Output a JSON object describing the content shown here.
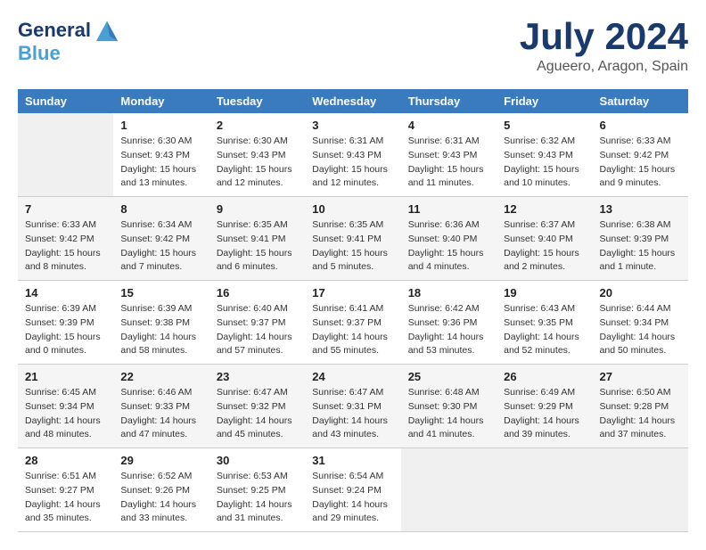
{
  "header": {
    "logo_line1": "General",
    "logo_line2": "Blue",
    "month": "July 2024",
    "location": "Agueero, Aragon, Spain"
  },
  "weekdays": [
    "Sunday",
    "Monday",
    "Tuesday",
    "Wednesday",
    "Thursday",
    "Friday",
    "Saturday"
  ],
  "weeks": [
    [
      {
        "day": "",
        "info": ""
      },
      {
        "day": "1",
        "info": "Sunrise: 6:30 AM\nSunset: 9:43 PM\nDaylight: 15 hours\nand 13 minutes."
      },
      {
        "day": "2",
        "info": "Sunrise: 6:30 AM\nSunset: 9:43 PM\nDaylight: 15 hours\nand 12 minutes."
      },
      {
        "day": "3",
        "info": "Sunrise: 6:31 AM\nSunset: 9:43 PM\nDaylight: 15 hours\nand 12 minutes."
      },
      {
        "day": "4",
        "info": "Sunrise: 6:31 AM\nSunset: 9:43 PM\nDaylight: 15 hours\nand 11 minutes."
      },
      {
        "day": "5",
        "info": "Sunrise: 6:32 AM\nSunset: 9:43 PM\nDaylight: 15 hours\nand 10 minutes."
      },
      {
        "day": "6",
        "info": "Sunrise: 6:33 AM\nSunset: 9:42 PM\nDaylight: 15 hours\nand 9 minutes."
      }
    ],
    [
      {
        "day": "7",
        "info": "Sunrise: 6:33 AM\nSunset: 9:42 PM\nDaylight: 15 hours\nand 8 minutes."
      },
      {
        "day": "8",
        "info": "Sunrise: 6:34 AM\nSunset: 9:42 PM\nDaylight: 15 hours\nand 7 minutes."
      },
      {
        "day": "9",
        "info": "Sunrise: 6:35 AM\nSunset: 9:41 PM\nDaylight: 15 hours\nand 6 minutes."
      },
      {
        "day": "10",
        "info": "Sunrise: 6:35 AM\nSunset: 9:41 PM\nDaylight: 15 hours\nand 5 minutes."
      },
      {
        "day": "11",
        "info": "Sunrise: 6:36 AM\nSunset: 9:40 PM\nDaylight: 15 hours\nand 4 minutes."
      },
      {
        "day": "12",
        "info": "Sunrise: 6:37 AM\nSunset: 9:40 PM\nDaylight: 15 hours\nand 2 minutes."
      },
      {
        "day": "13",
        "info": "Sunrise: 6:38 AM\nSunset: 9:39 PM\nDaylight: 15 hours\nand 1 minute."
      }
    ],
    [
      {
        "day": "14",
        "info": "Sunrise: 6:39 AM\nSunset: 9:39 PM\nDaylight: 15 hours\nand 0 minutes."
      },
      {
        "day": "15",
        "info": "Sunrise: 6:39 AM\nSunset: 9:38 PM\nDaylight: 14 hours\nand 58 minutes."
      },
      {
        "day": "16",
        "info": "Sunrise: 6:40 AM\nSunset: 9:37 PM\nDaylight: 14 hours\nand 57 minutes."
      },
      {
        "day": "17",
        "info": "Sunrise: 6:41 AM\nSunset: 9:37 PM\nDaylight: 14 hours\nand 55 minutes."
      },
      {
        "day": "18",
        "info": "Sunrise: 6:42 AM\nSunset: 9:36 PM\nDaylight: 14 hours\nand 53 minutes."
      },
      {
        "day": "19",
        "info": "Sunrise: 6:43 AM\nSunset: 9:35 PM\nDaylight: 14 hours\nand 52 minutes."
      },
      {
        "day": "20",
        "info": "Sunrise: 6:44 AM\nSunset: 9:34 PM\nDaylight: 14 hours\nand 50 minutes."
      }
    ],
    [
      {
        "day": "21",
        "info": "Sunrise: 6:45 AM\nSunset: 9:34 PM\nDaylight: 14 hours\nand 48 minutes."
      },
      {
        "day": "22",
        "info": "Sunrise: 6:46 AM\nSunset: 9:33 PM\nDaylight: 14 hours\nand 47 minutes."
      },
      {
        "day": "23",
        "info": "Sunrise: 6:47 AM\nSunset: 9:32 PM\nDaylight: 14 hours\nand 45 minutes."
      },
      {
        "day": "24",
        "info": "Sunrise: 6:47 AM\nSunset: 9:31 PM\nDaylight: 14 hours\nand 43 minutes."
      },
      {
        "day": "25",
        "info": "Sunrise: 6:48 AM\nSunset: 9:30 PM\nDaylight: 14 hours\nand 41 minutes."
      },
      {
        "day": "26",
        "info": "Sunrise: 6:49 AM\nSunset: 9:29 PM\nDaylight: 14 hours\nand 39 minutes."
      },
      {
        "day": "27",
        "info": "Sunrise: 6:50 AM\nSunset: 9:28 PM\nDaylight: 14 hours\nand 37 minutes."
      }
    ],
    [
      {
        "day": "28",
        "info": "Sunrise: 6:51 AM\nSunset: 9:27 PM\nDaylight: 14 hours\nand 35 minutes."
      },
      {
        "day": "29",
        "info": "Sunrise: 6:52 AM\nSunset: 9:26 PM\nDaylight: 14 hours\nand 33 minutes."
      },
      {
        "day": "30",
        "info": "Sunrise: 6:53 AM\nSunset: 9:25 PM\nDaylight: 14 hours\nand 31 minutes."
      },
      {
        "day": "31",
        "info": "Sunrise: 6:54 AM\nSunset: 9:24 PM\nDaylight: 14 hours\nand 29 minutes."
      },
      {
        "day": "",
        "info": ""
      },
      {
        "day": "",
        "info": ""
      },
      {
        "day": "",
        "info": ""
      }
    ]
  ]
}
